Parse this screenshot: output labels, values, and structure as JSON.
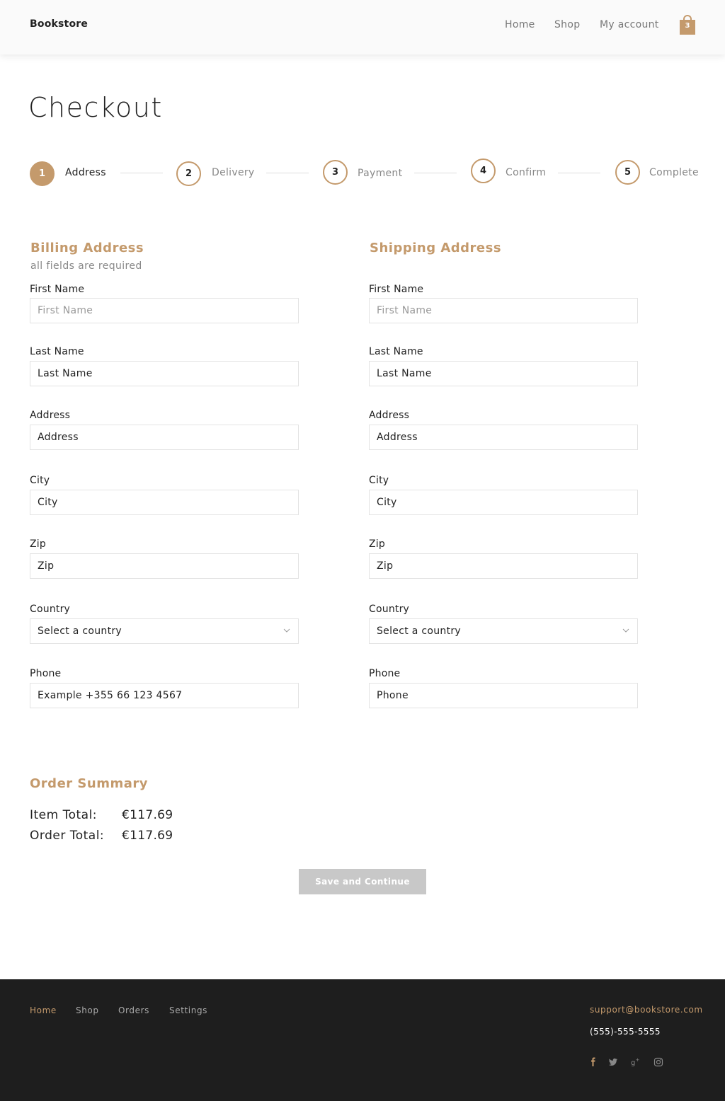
{
  "header": {
    "brand": "Bookstore",
    "nav": [
      "Home",
      "Shop",
      "My account"
    ],
    "cart_count": "3"
  },
  "page": {
    "title": "Checkout"
  },
  "steps": [
    {
      "num": "1",
      "label": "Address",
      "active": true
    },
    {
      "num": "2",
      "label": "Delivery",
      "active": false
    },
    {
      "num": "3",
      "label": "Payment",
      "active": false
    },
    {
      "num": "4",
      "label": "Confirm",
      "active": false
    },
    {
      "num": "5",
      "label": "Complete",
      "active": false
    }
  ],
  "billing": {
    "title": "Billing Address",
    "subtitle": "all fields are required",
    "first_name": {
      "label": "First Name",
      "placeholder": "First Name",
      "value": ""
    },
    "last_name": {
      "label": "Last Name",
      "value": "Last Name"
    },
    "address": {
      "label": "Address",
      "value": "Address"
    },
    "city": {
      "label": "City",
      "value": "City"
    },
    "zip": {
      "label": "Zip",
      "value": "Zip"
    },
    "country": {
      "label": "Country",
      "value": "Select a country"
    },
    "phone": {
      "label": "Phone",
      "value": "Example +355 66 123 4567"
    }
  },
  "shipping": {
    "title": "Shipping Address",
    "first_name": {
      "label": "First Name",
      "placeholder": "First Name",
      "value": ""
    },
    "last_name": {
      "label": "Last Name",
      "value": "Last Name"
    },
    "address": {
      "label": "Address",
      "value": "Address"
    },
    "city": {
      "label": "City",
      "value": "City"
    },
    "zip": {
      "label": "Zip",
      "value": "Zip"
    },
    "country": {
      "label": "Country",
      "value": "Select a country"
    },
    "phone": {
      "label": "Phone",
      "value": "Phone"
    }
  },
  "summary": {
    "title": "Order Summary",
    "item_total_label": "Item Total:",
    "item_total_value": "€117.69",
    "order_total_label": "Order Total:",
    "order_total_value": "€117.69"
  },
  "actions": {
    "save_continue": "Save and Continue"
  },
  "footer": {
    "links": [
      "Home",
      "Shop",
      "Orders",
      "Settings"
    ],
    "email": "support@bookstore.com",
    "phone": "(555)-555-5555",
    "social_icons": [
      "facebook-icon",
      "twitter-icon",
      "google-plus-icon",
      "instagram-icon"
    ]
  },
  "colors": {
    "accent": "#c49a6c",
    "footer_bg": "#1e1e1e",
    "button_disabled": "#c8c8c8"
  }
}
